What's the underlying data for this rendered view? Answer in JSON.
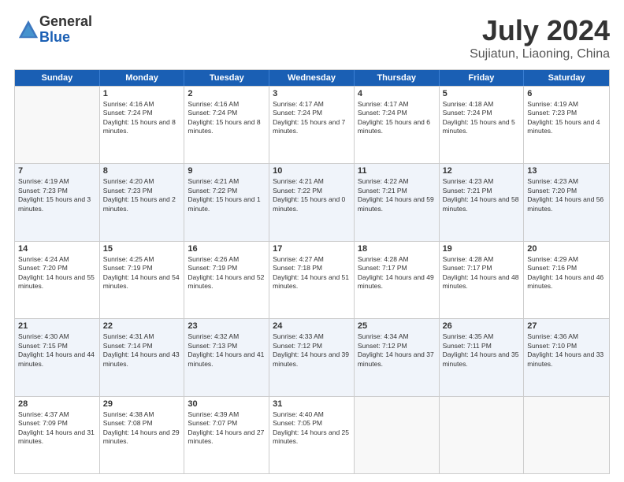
{
  "header": {
    "logo": {
      "general": "General",
      "blue": "Blue"
    },
    "title": "July 2024",
    "subtitle": "Sujiatun, Liaoning, China"
  },
  "calendar": {
    "days": [
      "Sunday",
      "Monday",
      "Tuesday",
      "Wednesday",
      "Thursday",
      "Friday",
      "Saturday"
    ],
    "rows": [
      [
        {
          "day": "",
          "empty": true
        },
        {
          "day": "1",
          "sunrise": "4:16 AM",
          "sunset": "7:24 PM",
          "daylight": "15 hours and 8 minutes."
        },
        {
          "day": "2",
          "sunrise": "4:16 AM",
          "sunset": "7:24 PM",
          "daylight": "15 hours and 8 minutes."
        },
        {
          "day": "3",
          "sunrise": "4:17 AM",
          "sunset": "7:24 PM",
          "daylight": "15 hours and 7 minutes."
        },
        {
          "day": "4",
          "sunrise": "4:17 AM",
          "sunset": "7:24 PM",
          "daylight": "15 hours and 6 minutes."
        },
        {
          "day": "5",
          "sunrise": "4:18 AM",
          "sunset": "7:24 PM",
          "daylight": "15 hours and 5 minutes."
        },
        {
          "day": "6",
          "sunrise": "4:19 AM",
          "sunset": "7:23 PM",
          "daylight": "15 hours and 4 minutes."
        }
      ],
      [
        {
          "day": "7",
          "sunrise": "4:19 AM",
          "sunset": "7:23 PM",
          "daylight": "15 hours and 3 minutes."
        },
        {
          "day": "8",
          "sunrise": "4:20 AM",
          "sunset": "7:23 PM",
          "daylight": "15 hours and 2 minutes."
        },
        {
          "day": "9",
          "sunrise": "4:21 AM",
          "sunset": "7:22 PM",
          "daylight": "15 hours and 1 minute."
        },
        {
          "day": "10",
          "sunrise": "4:21 AM",
          "sunset": "7:22 PM",
          "daylight": "15 hours and 0 minutes."
        },
        {
          "day": "11",
          "sunrise": "4:22 AM",
          "sunset": "7:21 PM",
          "daylight": "14 hours and 59 minutes."
        },
        {
          "day": "12",
          "sunrise": "4:23 AM",
          "sunset": "7:21 PM",
          "daylight": "14 hours and 58 minutes."
        },
        {
          "day": "13",
          "sunrise": "4:23 AM",
          "sunset": "7:20 PM",
          "daylight": "14 hours and 56 minutes."
        }
      ],
      [
        {
          "day": "14",
          "sunrise": "4:24 AM",
          "sunset": "7:20 PM",
          "daylight": "14 hours and 55 minutes."
        },
        {
          "day": "15",
          "sunrise": "4:25 AM",
          "sunset": "7:19 PM",
          "daylight": "14 hours and 54 minutes."
        },
        {
          "day": "16",
          "sunrise": "4:26 AM",
          "sunset": "7:19 PM",
          "daylight": "14 hours and 52 minutes."
        },
        {
          "day": "17",
          "sunrise": "4:27 AM",
          "sunset": "7:18 PM",
          "daylight": "14 hours and 51 minutes."
        },
        {
          "day": "18",
          "sunrise": "4:28 AM",
          "sunset": "7:17 PM",
          "daylight": "14 hours and 49 minutes."
        },
        {
          "day": "19",
          "sunrise": "4:28 AM",
          "sunset": "7:17 PM",
          "daylight": "14 hours and 48 minutes."
        },
        {
          "day": "20",
          "sunrise": "4:29 AM",
          "sunset": "7:16 PM",
          "daylight": "14 hours and 46 minutes."
        }
      ],
      [
        {
          "day": "21",
          "sunrise": "4:30 AM",
          "sunset": "7:15 PM",
          "daylight": "14 hours and 44 minutes."
        },
        {
          "day": "22",
          "sunrise": "4:31 AM",
          "sunset": "7:14 PM",
          "daylight": "14 hours and 43 minutes."
        },
        {
          "day": "23",
          "sunrise": "4:32 AM",
          "sunset": "7:13 PM",
          "daylight": "14 hours and 41 minutes."
        },
        {
          "day": "24",
          "sunrise": "4:33 AM",
          "sunset": "7:12 PM",
          "daylight": "14 hours and 39 minutes."
        },
        {
          "day": "25",
          "sunrise": "4:34 AM",
          "sunset": "7:12 PM",
          "daylight": "14 hours and 37 minutes."
        },
        {
          "day": "26",
          "sunrise": "4:35 AM",
          "sunset": "7:11 PM",
          "daylight": "14 hours and 35 minutes."
        },
        {
          "day": "27",
          "sunrise": "4:36 AM",
          "sunset": "7:10 PM",
          "daylight": "14 hours and 33 minutes."
        }
      ],
      [
        {
          "day": "28",
          "sunrise": "4:37 AM",
          "sunset": "7:09 PM",
          "daylight": "14 hours and 31 minutes."
        },
        {
          "day": "29",
          "sunrise": "4:38 AM",
          "sunset": "7:08 PM",
          "daylight": "14 hours and 29 minutes."
        },
        {
          "day": "30",
          "sunrise": "4:39 AM",
          "sunset": "7:07 PM",
          "daylight": "14 hours and 27 minutes."
        },
        {
          "day": "31",
          "sunrise": "4:40 AM",
          "sunset": "7:05 PM",
          "daylight": "14 hours and 25 minutes."
        },
        {
          "day": "",
          "empty": true
        },
        {
          "day": "",
          "empty": true
        },
        {
          "day": "",
          "empty": true
        }
      ]
    ]
  }
}
